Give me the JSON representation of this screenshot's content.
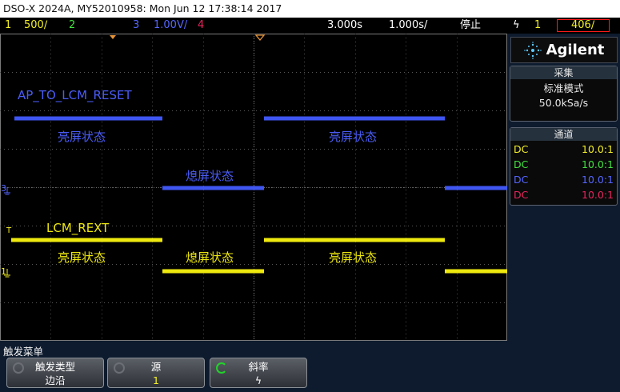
{
  "title": "DSO-X 2024A, MY52010958: Mon Jun 12 17:38:14 2017",
  "status": {
    "ch1_num": "1",
    "ch1_scale": "500∕",
    "ch2_num": "2",
    "ch3_num": "3",
    "ch3_scale": "1.00V/",
    "ch4_num": "4",
    "time_delay": "3.000s",
    "time_scale": "1.000s/",
    "run_state": "停止",
    "trigger_slope": "ϟ",
    "trigger_source": "1",
    "trigger_level": "406∕"
  },
  "brand": {
    "name": "Agilent"
  },
  "acquisition": {
    "header": "采集",
    "mode": "标准模式",
    "rate": "50.0kSa/s"
  },
  "channels": {
    "header": "通道",
    "rows": [
      {
        "coupling": "DC",
        "probe": "10.0:1",
        "color": "#f3ef26"
      },
      {
        "coupling": "DC",
        "probe": "10.0:1",
        "color": "#41e13f"
      },
      {
        "coupling": "DC",
        "probe": "10.0:1",
        "color": "#5666ff"
      },
      {
        "coupling": "DC",
        "probe": "10.0:1",
        "color": "#e8245e"
      }
    ]
  },
  "scope": {
    "ch3_label": "AP_TO_LCM_RESET",
    "ch1_label": "LCM_REXT",
    "on_state": "亮屏状态",
    "off_state": "熄屏状态",
    "marker_3": "3",
    "marker_1": "1",
    "marker_t": "T",
    "ch3_color": "#3f56f2",
    "ch1_color": "#eee80f"
  },
  "menu": {
    "title": "触发菜单",
    "softkeys": [
      {
        "label": "触发类型",
        "value": "边沿"
      },
      {
        "label": "源",
        "value": "1"
      },
      {
        "label": "斜率",
        "value": "ϟ"
      }
    ]
  }
}
